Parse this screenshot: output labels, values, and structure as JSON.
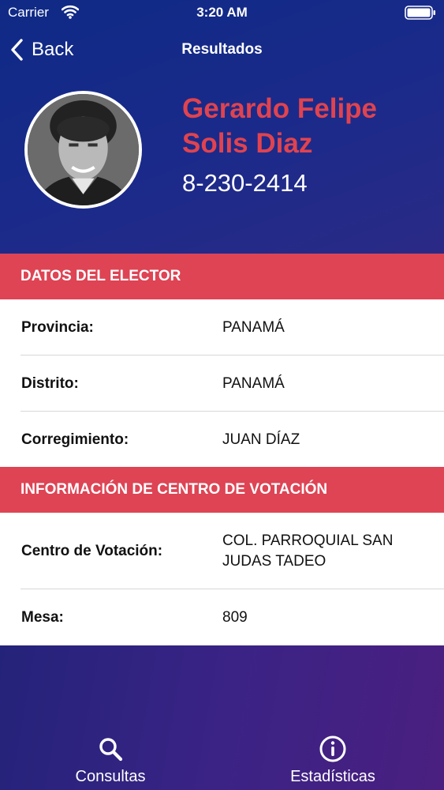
{
  "status_bar": {
    "carrier": "Carrier",
    "time": "3:20 AM"
  },
  "nav": {
    "back_label": "Back",
    "title": "Resultados"
  },
  "profile": {
    "name_line1": "Gerardo Felipe",
    "name_line2": "Solis Diaz",
    "id_number": "8-230-2414"
  },
  "elector_section": {
    "header": "DATOS DEL ELECTOR",
    "rows": [
      {
        "label": "Provincia:",
        "value": "PANAMÁ"
      },
      {
        "label": "Distrito:",
        "value": "PANAMÁ"
      },
      {
        "label": "Corregimiento:",
        "value": "JUAN DÍAZ"
      }
    ]
  },
  "center_section": {
    "header": "INFORMACIÓN DE CENTRO DE VOTACIÓN",
    "rows": [
      {
        "label": "Centro de Votación:",
        "value": "COL. PARROQUIAL SAN JUDAS TADEO"
      },
      {
        "label": "Mesa:",
        "value": "809"
      }
    ]
  },
  "tabs": [
    {
      "label": "Consultas",
      "icon": "search-icon"
    },
    {
      "label": "Estadísticas",
      "icon": "info-icon"
    }
  ],
  "colors": {
    "accent_red": "#de4454",
    "name_red": "#e0434f",
    "header_blue": "#0f2a86",
    "footer_purple": "#3a2385"
  }
}
